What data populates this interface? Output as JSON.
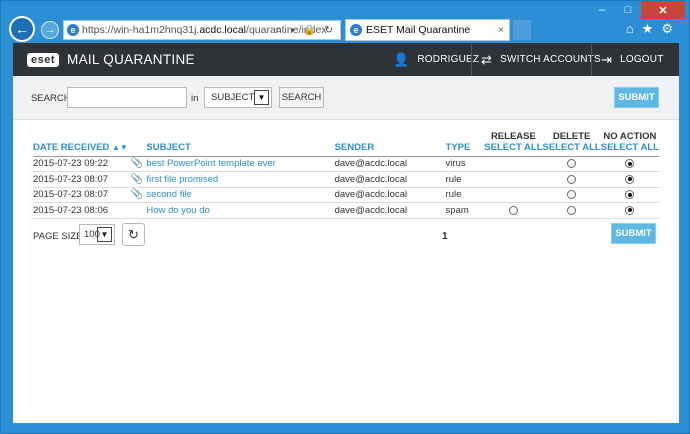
{
  "browser": {
    "url_prefix": "https://win-ha1m2hnq31j.",
    "url_domain": "acdc.local",
    "url_path": "/quarantine/index",
    "addr_tools": "⌕ ▾ 🔒 ↻",
    "tab_title": "ESET Mail Quarantine",
    "tab_close": "×",
    "back_glyph": "←",
    "fwd_glyph": "→",
    "right_tools": "⌂★⚙",
    "ie_glyph": "e",
    "window_min": "–",
    "window_max": "□",
    "window_close": "✕"
  },
  "header": {
    "logo": "eset",
    "title": "MAIL QUARANTINE",
    "user_icon": "👤",
    "user": "RODRIGUEZ",
    "switch_icon": "⇄",
    "switch_accounts": "SWITCH ACCOUNTS",
    "logout_icon": "⇥",
    "logout": "LOGOUT"
  },
  "search": {
    "label": "SEARCH",
    "in_label": "in",
    "field_value": "",
    "field_select": "SUBJECT",
    "select_arrow": "▼",
    "search_button": "SEARCH",
    "submit_button": "SUBMIT"
  },
  "table": {
    "columns": {
      "date": "DATE RECEIVED",
      "sort_glyph": "▲▼",
      "subject": "SUBJECT",
      "sender": "SENDER",
      "type": "TYPE",
      "release": "RELEASE",
      "delete": "DELETE",
      "no_action": "NO ACTION",
      "select_all": "SELECT ALL"
    },
    "clip_glyph": "📎",
    "rows": [
      {
        "date": "2015-07-23 09:22",
        "subject": "best PowerPoint template ever",
        "sender": "dave@acdc.local",
        "type": "virus"
      },
      {
        "date": "2015-07-23 08:07",
        "subject": "first file promised",
        "sender": "dave@acdc.local",
        "type": "rule"
      },
      {
        "date": "2015-07-23 08:07",
        "subject": "second file",
        "sender": "dave@acdc.local",
        "type": "rule"
      },
      {
        "date": "2015-07-23 08:06",
        "subject": "How do you do",
        "sender": "dave@acdc.local",
        "type": "spam"
      }
    ]
  },
  "footer": {
    "page_size_label": "PAGE SIZE",
    "page_size": "100",
    "select_arrow": "▼",
    "refresh_glyph": "↻",
    "page": "1",
    "submit_button": "SUBMIT"
  },
  "colors": {
    "chrome_blue": "#2b8fd6",
    "header_dark": "#2f3337",
    "link_blue": "#2d8fcc",
    "submit_blue": "#5cb8e4"
  }
}
